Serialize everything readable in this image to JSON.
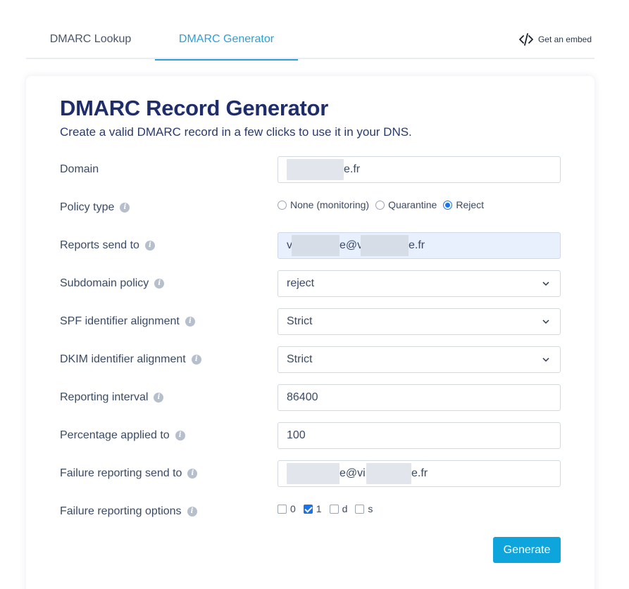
{
  "tabs": [
    {
      "label": "DMARC Lookup",
      "active": false
    },
    {
      "label": "DMARC Generator",
      "active": true
    }
  ],
  "embed": {
    "label": "Get an embed",
    "icon": "code-icon"
  },
  "card": {
    "title": "DMARC Record Generator",
    "subtitle": "Create a valid DMARC record in a few clicks to use it in your DNS."
  },
  "form": {
    "domain": {
      "label": "Domain",
      "value_suffix": "e.fr"
    },
    "policy_type": {
      "label": "Policy type",
      "options": [
        "None (monitoring)",
        "Quarantine",
        "Reject"
      ],
      "selected": "Reject"
    },
    "reports_send_to": {
      "label": "Reports send to",
      "value_prefix": "v",
      "value_mid": "e@v",
      "value_suffix": "e.fr"
    },
    "subdomain_policy": {
      "label": "Subdomain policy",
      "value": "reject"
    },
    "spf_alignment": {
      "label": "SPF identifier alignment",
      "value": "Strict"
    },
    "dkim_alignment": {
      "label": "DKIM identifier alignment",
      "value": "Strict"
    },
    "reporting_interval": {
      "label": "Reporting interval",
      "value": "86400"
    },
    "percentage": {
      "label": "Percentage applied to",
      "value": "100"
    },
    "failure_send_to": {
      "label": "Failure reporting send to",
      "value_mid": "e@vi",
      "value_suffix": "e.fr"
    },
    "failure_options": {
      "label": "Failure reporting options",
      "options": [
        {
          "label": "0",
          "checked": false
        },
        {
          "label": "1",
          "checked": true
        },
        {
          "label": "d",
          "checked": false
        },
        {
          "label": "s",
          "checked": false
        }
      ]
    }
  },
  "generate_label": "Generate",
  "colors": {
    "accent": "#2d9fd8",
    "title": "#1f2d6b",
    "button": "#0ea5dd",
    "check": "#1a73e8"
  }
}
